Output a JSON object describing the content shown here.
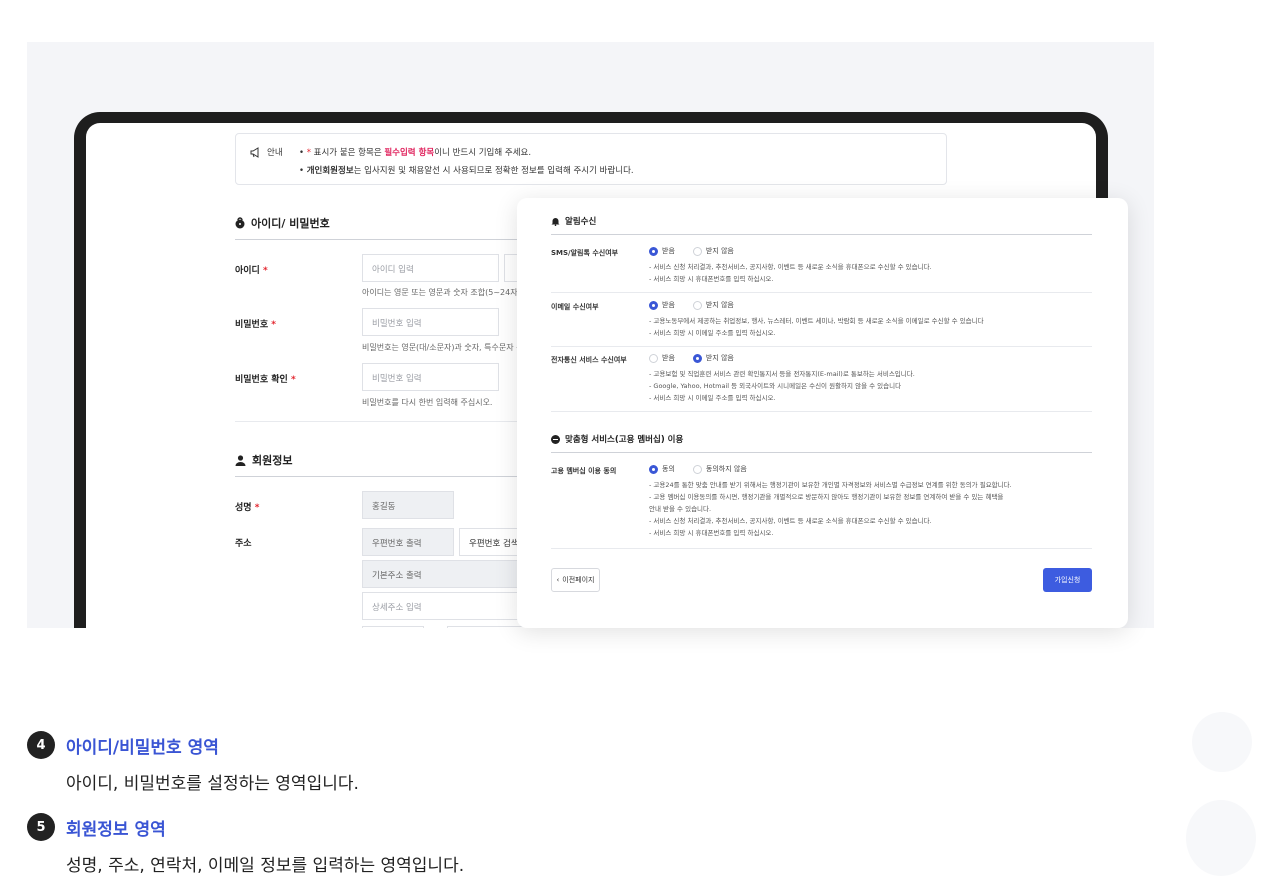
{
  "notice": {
    "label": "안내",
    "line1_bullet": "•",
    "line1_star": "*",
    "line1_pre": "표시가 붙은 항목은 ",
    "line1_highlight": "필수입력 항목",
    "line1_post": "이니 반드시 기입해 주세요.",
    "line2_bullet": "•",
    "line2_bold": "개인회원정보",
    "line2_post": "는 입사지원 및 채용알선 시 사용되므로 정확한 정보를 입력해 주시기 바랍니다."
  },
  "account_section": {
    "title": "아이디/ 비밀번호",
    "id_label": "아이디",
    "id_placeholder": "아이디 입력",
    "id_help": "아이디는 영문 또는 영문과 숫자 조합(5~24자)로 입",
    "pw_label": "비밀번호",
    "pw_placeholder": "비밀번호 입력",
    "pw_help": "비밀번호는 영문(대/소문자)과 숫자, 특수문자 중 3",
    "pw_confirm_label": "비밀번호 확인",
    "pw_confirm_placeholder": "비밀번호 입력",
    "pw_confirm_help": "비밀번호를 다시 한번 입력해 주십시오.",
    "required_mark": "*"
  },
  "member_section": {
    "title": "회원정보",
    "name_label": "성명",
    "name_value": "홍길동",
    "address_label": "주소",
    "zip_value": "우편번호 출력",
    "zip_button": "우편번호 검색",
    "addr_basic": "기본주소 출력",
    "addr_detail_placeholder": "상세주소 입력",
    "required_mark": "*"
  },
  "alert_card": {
    "title": "알림수신",
    "sms_label": "SMS/알림톡 수신여부",
    "sms_opt_yes": "받음",
    "sms_opt_no": "받지 않음",
    "sms_notes": [
      "- 서비스 신청 처리결과, 추천서비스, 공지사항, 이벤트 등 새로운 소식을 휴대폰으로 수신할 수 있습니다.",
      "- 서비스 희망 시 휴대폰번호를 입력 하십시오."
    ],
    "email_label": "이메일 수신여부",
    "email_opt_yes": "받음",
    "email_opt_no": "받지 않음",
    "email_notes": [
      "- 고용노동부에서 제공하는 취업정보, 행사, 뉴스레터, 이벤트 세미나, 박람회 등 새로운 소식을 이메일로 수신할 수 있습니다",
      "- 서비스 희망 시 이메일 주소를 입력 하십시오."
    ],
    "edoc_label": "전자통신 서비스 수신여부",
    "edoc_opt_yes": "받음",
    "edoc_opt_no": "받지 않음",
    "edoc_notes": [
      "- 고용보험 및 직업훈련 서비스 관련 확인통지서 등을 전자통지(E-mail)로 통보하는 서비스입니다.",
      "- Google, Yahoo, Hotmail 등 외국사이트와 시니메일은 수신이 원활하지 않을 수 있습니다",
      "- 서비스 희망 시 이메일 주소를 입력 하십시오."
    ],
    "custom_title": "맞춤형 서비스(고용 멤버십) 이용",
    "membership_label": "고용 멤버십 이용 동의",
    "membership_opt_yes": "동의",
    "membership_opt_no": "동의하지 않음",
    "membership_notes": [
      "- 고용24를 통한 맞춤 안내를 받기 위해서는 행정기관이 보유한 개인별 자격정보와 서비스별 수급정보 연계를 위한 동의가 필요합니다.",
      "- 고용 멤버십 이용동의를 하시면, 행정기관을 개별적으로 방문하지 않아도 행정기관이 보유한 정보를 연계하여 받을 수 있는 혜택을",
      "  안내 받을 수 있습니다.",
      "- 서비스 신청 처리결과, 추천서비스, 공지사항, 이벤트 등 새로운 소식을 휴대폰으로 수신할 수 있습니다.",
      "- 서비스 희망 시 휴대폰번호를 입력 하십시오."
    ],
    "prev_button": "이전페이지",
    "prev_chevron": "‹",
    "join_button": "가입신청"
  },
  "descriptions": [
    {
      "number": "4",
      "title": "아이디/비밀번호 영역",
      "text": "아이디, 비밀번호를 설정하는 영역입니다."
    },
    {
      "number": "5",
      "title": "회원정보 영역",
      "text": "성명, 주소, 연락처, 이메일 정보를 입력하는 영역입니다."
    }
  ],
  "colors": {
    "accent": "#3a55d4",
    "required": "#e3262f",
    "primary_button": "#3d5ce0"
  }
}
